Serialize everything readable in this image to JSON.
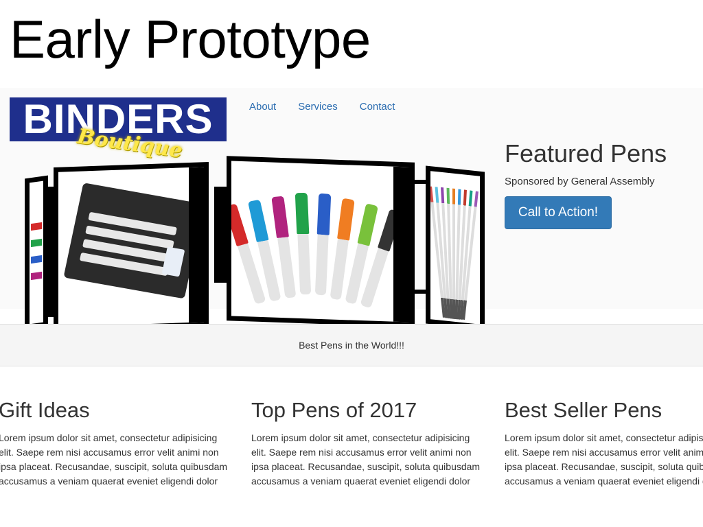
{
  "slide": {
    "title": "Early Prototype"
  },
  "site": {
    "logo": {
      "main": "BINDERS",
      "script": "Boutique"
    },
    "nav": {
      "items": [
        "About",
        "Services",
        "Contact"
      ]
    },
    "featured": {
      "title": "Featured Pens",
      "subtitle": "Sponsored by General Assembly",
      "cta_label": "Call to Action!"
    },
    "banner": {
      "text": "Best Pens in the World!!!"
    },
    "columns": [
      {
        "title": "Gift Ideas",
        "text": "Lorem ipsum dolor sit amet, consectetur adipisicing elit. Saepe rem nisi accusamus error velit animi non ipsa placeat. Recusandae, suscipit, soluta quibusdam accusamus a veniam quaerat eveniet eligendi dolor consectetur."
      },
      {
        "title": "Top Pens of 2017",
        "text": "Lorem ipsum dolor sit amet, consectetur adipisicing elit. Saepe rem nisi accusamus error velit animi non ipsa placeat. Recusandae, suscipit, soluta quibusdam accusamus a veniam quaerat eveniet eligendi dolor consectetur."
      },
      {
        "title": "Best Seller Pens",
        "text": "Lorem ipsum dolor sit amet, consectetur adipisicing elit. Saepe rem nisi accusamus error velit animi non ipsa placeat. Recusandae, suscipit, soluta quibusdam accusamus a veniam quaerat eveniet eligendi dolor consectetur."
      }
    ],
    "colors": {
      "link": "#2a6cb0",
      "cta": "#337ab7",
      "logo_bg": "#1f2f8c",
      "logo_script": "#ffe84a",
      "marker_caps": [
        "#d42a2a",
        "#1f9ad6",
        "#b0237e",
        "#21a24a",
        "#2a5ec7",
        "#f07d22",
        "#79c13b",
        "#333333"
      ]
    }
  }
}
